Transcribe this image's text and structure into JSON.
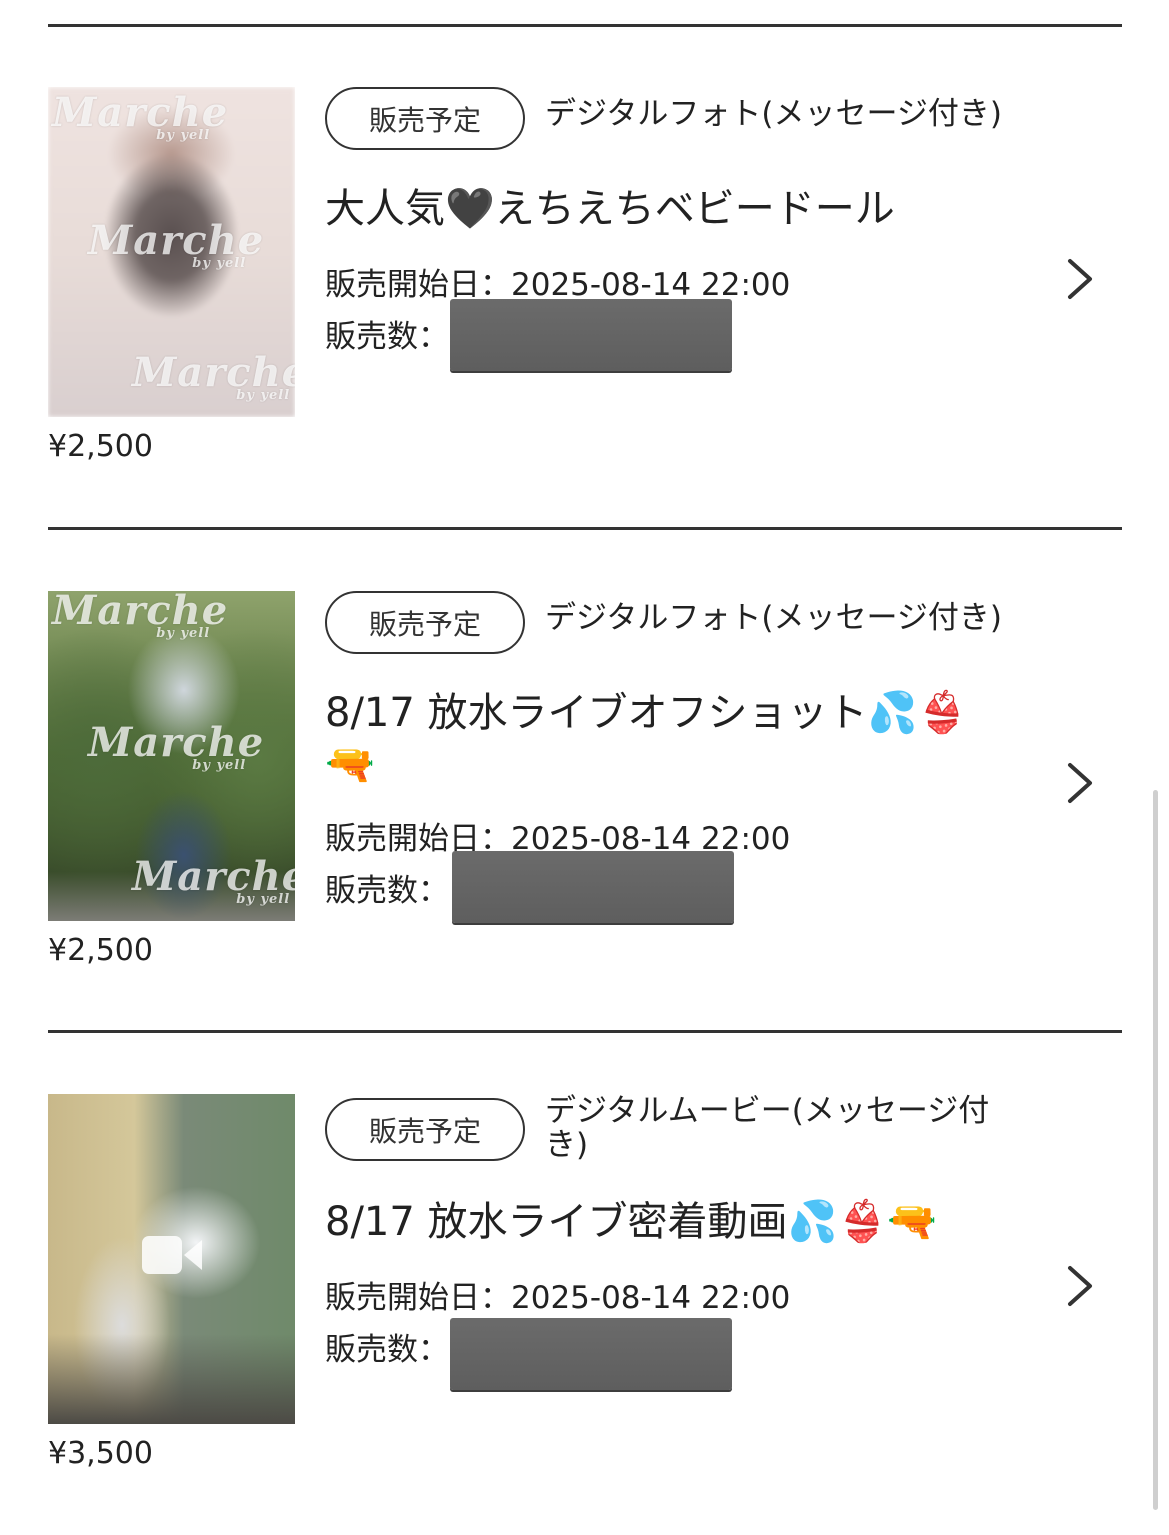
{
  "items": [
    {
      "badge": "販売予定",
      "product_type": "デジタルフォト(メッセージ付き)",
      "title": "大人気🖤えちえちベビードール",
      "sale_date": "販売開始日：2025-08-14 22:00",
      "sale_count_label": "販売数：",
      "price": "¥2,500",
      "watermark": "Marche",
      "watermark_sub": "by yell"
    },
    {
      "badge": "販売予定",
      "product_type": "デジタルフォト(メッセージ付き)",
      "title": "8/17 放水ライブオフショット💦👙🔫",
      "sale_date": "販売開始日：2025-08-14 22:00",
      "sale_count_label": "販売数：",
      "price": "¥2,500",
      "watermark": "Marche",
      "watermark_sub": "by yell"
    },
    {
      "badge": "販売予定",
      "product_type": "デジタルムービー(メッセージ付き)",
      "title": "8/17 放水ライブ密着動画💦👙🔫",
      "sale_date": "販売開始日：2025-08-14 22:00",
      "sale_count_label": "販売数：",
      "price": "¥3,500",
      "thumbnail_icon": "video-camera-icon"
    }
  ],
  "colors": {
    "text": "#222222",
    "divider": "#333333",
    "redaction": "#616161"
  }
}
